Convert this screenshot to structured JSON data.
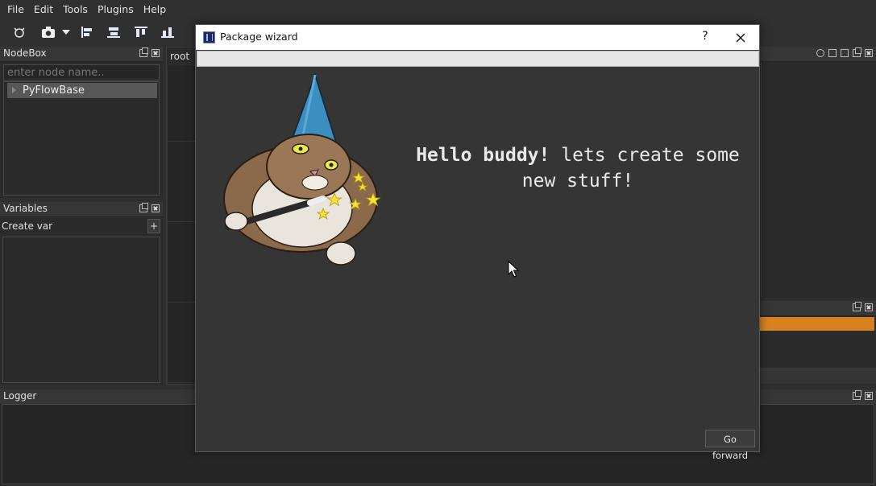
{
  "menubar": {
    "items": [
      "File",
      "Edit",
      "Tools",
      "Plugins",
      "Help"
    ]
  },
  "toolbar": {
    "icons": [
      "graph-icon",
      "screenshot-camera-icon",
      "dropdown-arrow-icon",
      "align-left-icon",
      "align-center-horizontal-icon",
      "align-top-icon",
      "align-bottom-icon"
    ]
  },
  "nodebox": {
    "title": "NodeBox",
    "search_placeholder": "enter node name..",
    "items": [
      "PyFlowBase"
    ]
  },
  "variables": {
    "title": "Variables",
    "create_label": "Create var",
    "add_label": "+"
  },
  "canvas": {
    "tab_label": "root"
  },
  "logger": {
    "title": "Logger"
  },
  "dialog": {
    "title": "Package wizard",
    "help_label": "?",
    "greeting_bold": "Hello buddy!",
    "greeting_rest": " lets create some new stuff!",
    "forward_label": "Go forward"
  },
  "colors": {
    "background": "#2f2f2f",
    "accent_orange": "#d7821f",
    "dialog_bg": "#353535"
  }
}
